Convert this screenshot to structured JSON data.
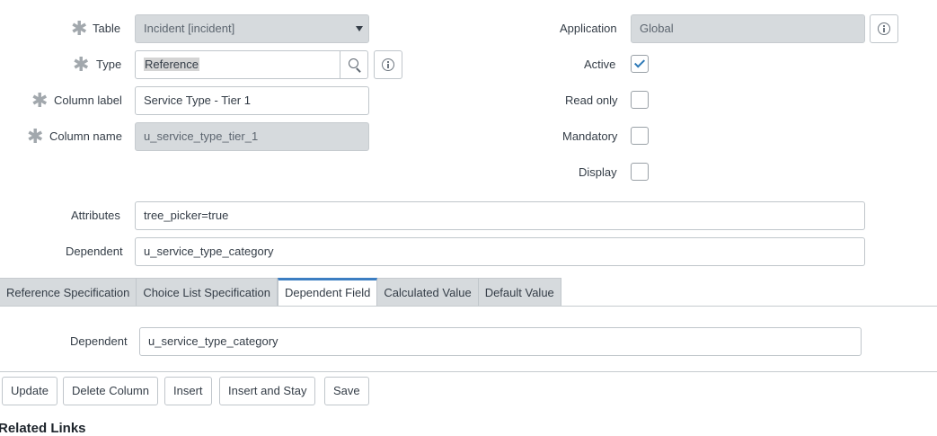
{
  "form": {
    "table": {
      "label": "Table",
      "value": "Incident [incident]"
    },
    "type": {
      "label": "Type",
      "value": "Reference"
    },
    "column_label": {
      "label": "Column label",
      "value": "Service Type - Tier 1"
    },
    "column_name": {
      "label": "Column name",
      "value": "u_service_type_tier_1"
    },
    "application": {
      "label": "Application",
      "value": "Global"
    },
    "active": {
      "label": "Active",
      "checked": true
    },
    "read_only": {
      "label": "Read only",
      "checked": false
    },
    "mandatory": {
      "label": "Mandatory",
      "checked": false
    },
    "display": {
      "label": "Display",
      "checked": false
    },
    "attributes": {
      "label": "Attributes",
      "value": "tree_picker=true"
    },
    "dependent": {
      "label": "Dependent",
      "value": "u_service_type_category"
    }
  },
  "required_marker": "✱",
  "tabs": [
    {
      "label": "Reference Specification",
      "active": false
    },
    {
      "label": "Choice List Specification",
      "active": false
    },
    {
      "label": "Dependent Field",
      "active": true
    },
    {
      "label": "Calculated Value",
      "active": false
    },
    {
      "label": "Default Value",
      "active": false
    }
  ],
  "tab_panel": {
    "dependent": {
      "label": "Dependent",
      "value": "u_service_type_category"
    }
  },
  "buttons": {
    "update": "Update",
    "delete_column": "Delete Column",
    "insert": "Insert",
    "insert_and_stay": "Insert and Stay",
    "save": "Save"
  },
  "related_links": {
    "title": "Related Links"
  },
  "colors": {
    "accent": "#3c7ec2",
    "readonly_bg": "#d6dadd",
    "check": "#2e79b7"
  }
}
